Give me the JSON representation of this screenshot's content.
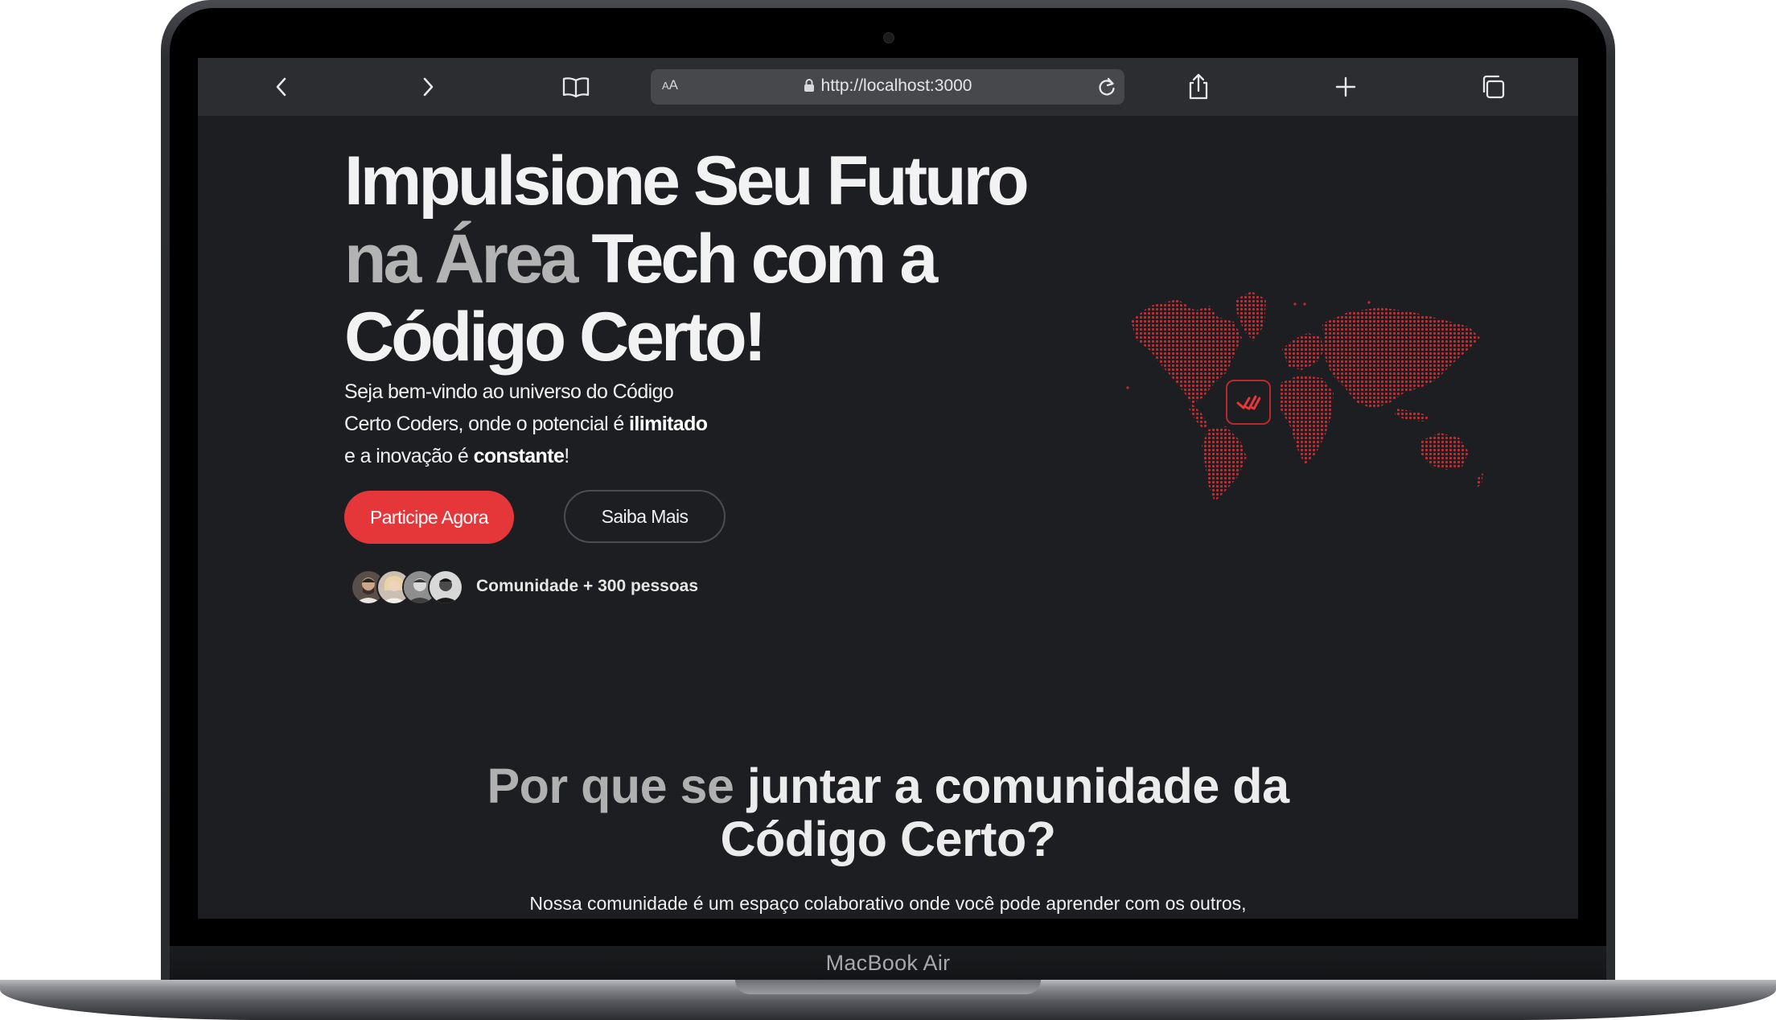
{
  "device": {
    "brand_label": "MacBook Air"
  },
  "browser": {
    "text_size_label": "AA",
    "url": "http://localhost:3000",
    "icons": [
      "chevron-left-icon",
      "chevron-right-icon",
      "book-icon",
      "lock-icon",
      "reload-icon",
      "share-icon",
      "plus-icon",
      "tabs-icon"
    ]
  },
  "hero": {
    "title_line1": "Impulsione Seu Futuro",
    "title_line2_dim": "na Área",
    "title_line2_rest": " Tech com a",
    "title_line3": "Código Certo!",
    "subtitle_p1": "Seja bem-vindo ao universo do Código Certo Coders, onde o potencial é ",
    "subtitle_b1": "ilimitado",
    "subtitle_p2": " e a inovação é ",
    "subtitle_b2": "constante",
    "subtitle_p3": "!",
    "primary_button": "Participe Agora",
    "secondary_button": "Saiba Mais",
    "community_label": "Comunidade + 300 pessoas",
    "accent_color": "#e5373a"
  },
  "section": {
    "title_dim": "Por que se",
    "title_rest": " juntar a comunidade da",
    "title_line2": "Código Certo?",
    "text": "Nossa comunidade é um espaço colaborativo onde você pode aprender com os outros,"
  }
}
